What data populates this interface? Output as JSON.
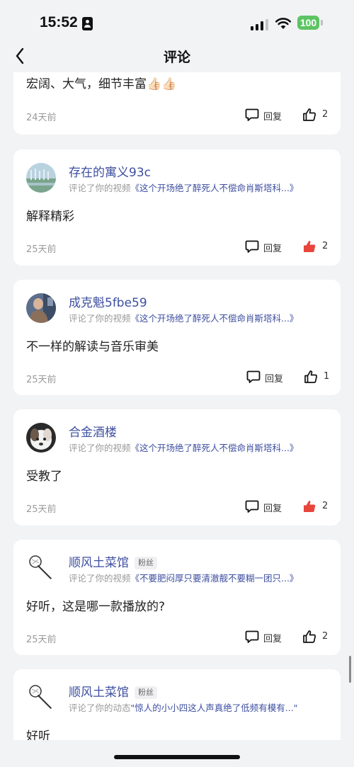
{
  "status_bar": {
    "time": "15:52",
    "battery": "100",
    "colors": {
      "battery": "#5dc463"
    }
  },
  "nav": {
    "title": "评论",
    "back_icon": "chevron-left-icon"
  },
  "colors": {
    "username": "#3e4fa0",
    "link": "#3e4fa0",
    "liked": "#e8453c",
    "background": "#f2f3f5"
  },
  "comments": [
    {
      "text": "宏阔、大气，细节丰富👍🏻👍🏻",
      "time": "24天前",
      "reply_label": "回复",
      "likes": "2",
      "liked": false
    },
    {
      "username": "存在的寓义93c",
      "action": "评论了你的视频",
      "target": "《这个开场绝了醉死人不偿命肖斯塔科...》",
      "text": "解释精彩",
      "time": "25天前",
      "reply_label": "回复",
      "likes": "2",
      "liked": true
    },
    {
      "username": "成克魁5fbe59",
      "action": "评论了你的视频",
      "target": "《这个开场绝了醉死人不偿命肖斯塔科...》",
      "text": "不一样的解读与音乐审美",
      "time": "25天前",
      "reply_label": "回复",
      "likes": "1",
      "liked": false
    },
    {
      "username": "合金酒楼",
      "action": "评论了你的视频",
      "target": "《这个开场绝了醉死人不偿命肖斯塔科...》",
      "text": "受教了",
      "time": "25天前",
      "reply_label": "回复",
      "likes": "2",
      "liked": true
    },
    {
      "username": "顺风土菜馆",
      "badge": "粉丝",
      "action": "评论了你的视频",
      "target": "《不要肥闷厚只要清澈靓不要糊一团只...》",
      "text": "好听，这是哪一款播放的?",
      "time": "25天前",
      "reply_label": "回复",
      "likes": "2",
      "liked": false
    },
    {
      "username": "顺风土菜馆",
      "badge": "粉丝",
      "action": "评论了你的动态",
      "target": "\"惊人的小小四这人声真绝了低频有模有...\"",
      "text": "好听"
    }
  ]
}
